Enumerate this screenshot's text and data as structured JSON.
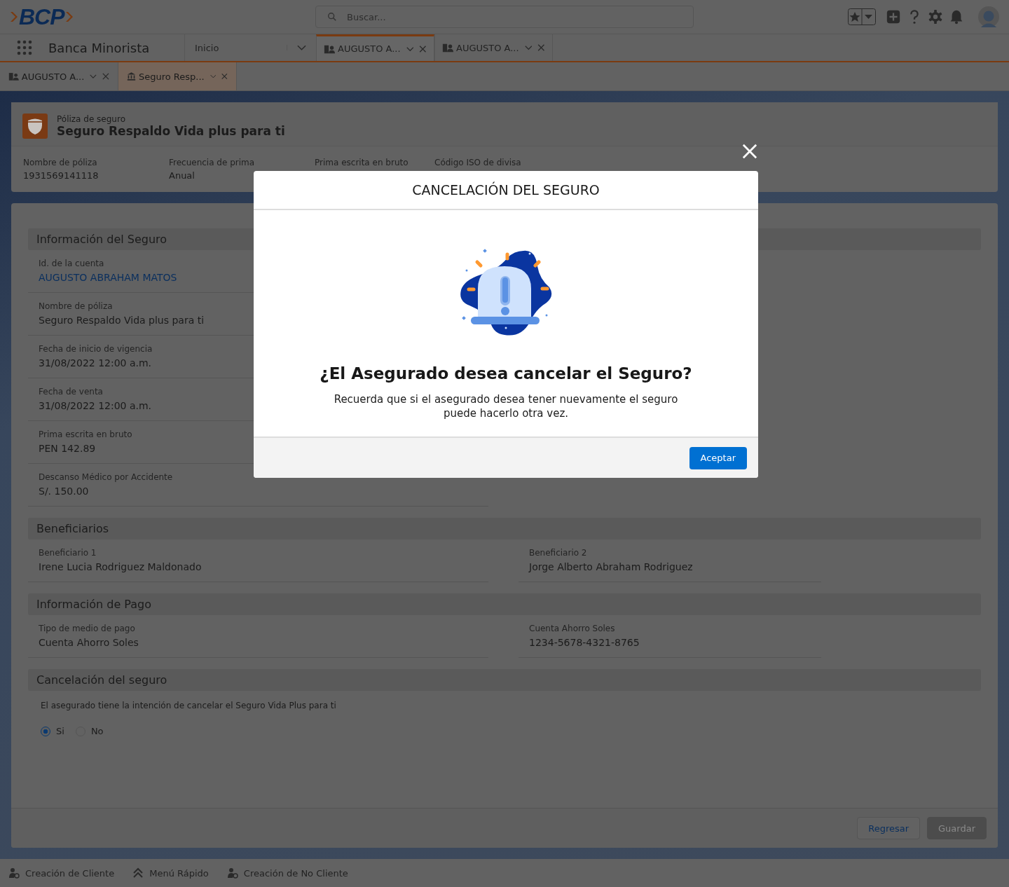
{
  "header": {
    "logo": "BCP",
    "search": {
      "placeholder": "Buscar..."
    }
  },
  "nav": {
    "app_name": "Banca Minorista",
    "tabs": [
      {
        "label": "Inicio",
        "kind": "home",
        "selected": false
      },
      {
        "label": "AUGUSTO A...",
        "kind": "account",
        "selected": true
      },
      {
        "label": "AUGUSTO A...",
        "kind": "account",
        "selected": false
      }
    ]
  },
  "subtabs": [
    {
      "label": "AUGUSTO A...",
      "kind": "account",
      "selected": false
    },
    {
      "label": "Seguro Resp...",
      "kind": "policy",
      "selected": true
    }
  ],
  "record": {
    "type": "Póliza de seguro",
    "title": "Seguro Respaldo Vida plus para ti",
    "highlights": [
      {
        "label": "Nombre de póliza",
        "value": "1931569141118"
      },
      {
        "label": "Frecuencia de prima",
        "value": "Anual"
      },
      {
        "label": "Prima escrita en bruto"
      },
      {
        "label": "Código ISO de divisa"
      }
    ]
  },
  "sections": [
    {
      "title": "Información del Seguro",
      "kind": "single",
      "fields": [
        {
          "label": "Id. de la cuenta",
          "value": "AUGUSTO ABRAHAM MATOS",
          "kind": "link"
        },
        {
          "label": "Nombre de póliza",
          "value": "Seguro Respaldo Vida plus para ti",
          "kind": "text"
        },
        {
          "label": "Fecha de inicio de vigencia",
          "value": "31/08/2022 12:00 a.m.",
          "kind": "text"
        },
        {
          "label": "Fecha de venta",
          "value": "31/08/2022 12:00 a.m.",
          "kind": "text"
        },
        {
          "label": "Prima escrita en bruto",
          "value": "PEN 142.89",
          "kind": "text"
        },
        {
          "label": "Descanso Médico por Accidente",
          "value": "S/. 150.00",
          "kind": "text"
        }
      ]
    },
    {
      "title": "Beneficiarios",
      "kind": "pairs",
      "fields": [
        {
          "label": "Beneficiario 1",
          "value": "Irene Lucia Rodriguez Maldonado",
          "kind": "text"
        },
        {
          "label": "Beneficiario 2",
          "value": "Jorge Alberto Abraham Rodriguez",
          "kind": "text"
        }
      ]
    },
    {
      "title": "Información de Pago",
      "kind": "pairs",
      "fields": [
        {
          "label": "Tipo de medio de pago",
          "value": "Cuenta Ahorro Soles",
          "kind": "text"
        },
        {
          "label": "Cuenta Ahorro Soles",
          "value": "1234-5678-4321-8765",
          "kind": "text"
        }
      ]
    }
  ],
  "cancellation": {
    "title": "Cancelación del seguro",
    "question": "El asegurado tiene la intención de cancelar el Seguro Vida Plus para ti",
    "options": [
      {
        "label": "Si",
        "selected": true
      },
      {
        "label": "No",
        "selected": false
      }
    ]
  },
  "actions": [
    {
      "label": "Regresar",
      "disabled": false
    },
    {
      "label": "Guardar",
      "disabled": true
    }
  ],
  "utility_bar": [
    {
      "label": "Creación de Cliente",
      "kind": "person-add"
    },
    {
      "label": "Menú Rápido",
      "kind": "chevrons"
    },
    {
      "label": "Creación de No Cliente",
      "kind": "person-add"
    }
  ],
  "modal": {
    "title": "CANCELACIÓN DEL SEGURO",
    "heading": "¿El Asegurado desea cancelar el Seguro?",
    "message": "Recuerda que si el asegurado desea tener nuevamente el seguro puede hacerlo otra vez.",
    "button": "Aceptar"
  }
}
